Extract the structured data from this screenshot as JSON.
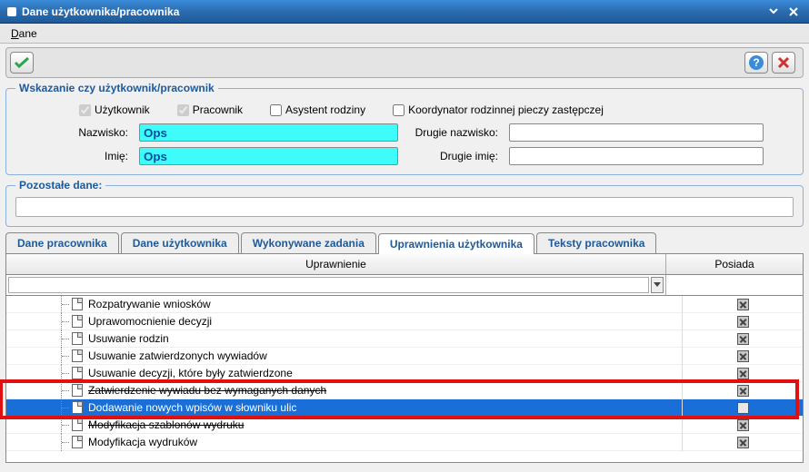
{
  "window": {
    "title": "Dane użytkownika/pracownika"
  },
  "menu": {
    "dane": "Dane"
  },
  "roles": {
    "legend": "Wskazanie czy użytkownik/pracownik",
    "user": "Użytkownik",
    "employee": "Pracownik",
    "assistant": "Asystent rodziny",
    "coordinator": "Koordynator rodzinnej pieczy zastępczej"
  },
  "names": {
    "lastname_label": "Nazwisko:",
    "lastname": "Ops",
    "lastname2_label": "Drugie nazwisko:",
    "lastname2": "",
    "firstname_label": "Imię:",
    "firstname": "Ops",
    "firstname2_label": "Drugie imię:",
    "firstname2": ""
  },
  "other": {
    "legend": "Pozostałe dane:",
    "value": ""
  },
  "tabs": {
    "t0": "Dane pracownika",
    "t1": "Dane użytkownika",
    "t2": "Wykonywane zadania",
    "t3": "Uprawnienia użytkownika",
    "t4": "Teksty pracownika"
  },
  "grid": {
    "col1": "Uprawnienie",
    "col2": "Posiada",
    "rows": [
      {
        "label": "Rozpatrywanie wniosków",
        "has": "x"
      },
      {
        "label": "Uprawomocnienie decyzji",
        "has": "x"
      },
      {
        "label": "Usuwanie rodzin",
        "has": "x"
      },
      {
        "label": "Usuwanie zatwierdzonych wywiadów",
        "has": "x"
      },
      {
        "label": "Usuwanie decyzji, które były zatwierdzone",
        "has": "x"
      },
      {
        "label": "Zatwierdzenie wywiadu bez wymaganych danych",
        "has": "x",
        "struck": true
      },
      {
        "label": "Dodawanie nowych wpisów w słowniku ulic",
        "has": "empty",
        "selected": true
      },
      {
        "label": "Modyfikacja szablonów wydruku",
        "has": "x",
        "struck": true
      },
      {
        "label": "Modyfikacja wydruków",
        "has": "x"
      }
    ]
  }
}
